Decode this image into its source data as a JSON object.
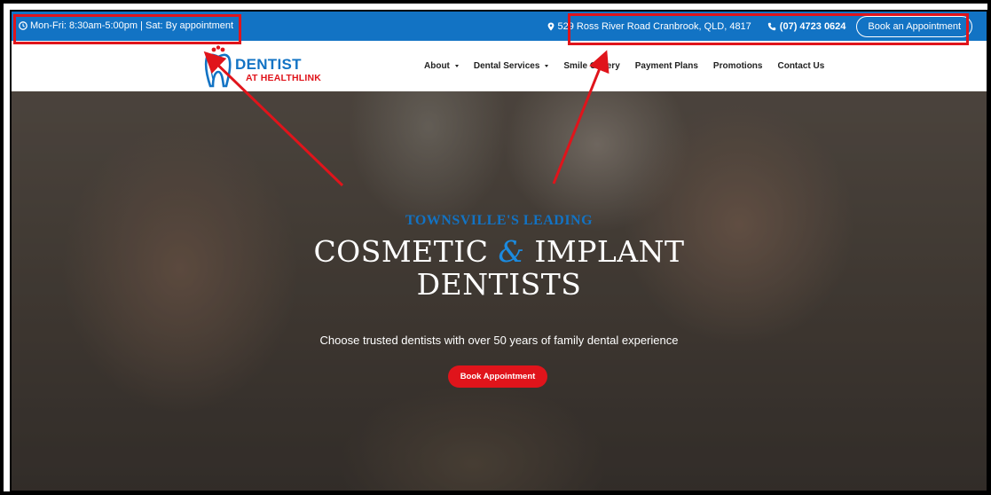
{
  "topbar": {
    "hours": "Mon-Fri: 8:30am-5:00pm | Sat: By appointment",
    "address": "529 Ross River Road Cranbrook, QLD, 4817",
    "phone": "(07) 4723 0624",
    "book_button": "Book an Appointment"
  },
  "logo": {
    "line1": "DENTIST",
    "line2": "AT HEALTHLINK"
  },
  "nav": {
    "items": [
      {
        "label": "About"
      },
      {
        "label": "Dental Services"
      },
      {
        "label": "Smile Gallery"
      },
      {
        "label": "Payment Plans"
      },
      {
        "label": "Promotions"
      },
      {
        "label": "Contact Us"
      }
    ]
  },
  "hero": {
    "kicker": "TOWNSVILLE'S LEADING",
    "headline_part1": "COSMETIC ",
    "headline_amp": "&",
    "headline_part2": " IMPLANT",
    "headline_line2": "DENTISTS",
    "subline": "Choose trusted dentists with over 50 years of family dental experience",
    "cta": "Book Appointment"
  },
  "colors": {
    "brand_blue": "#1273c4",
    "brand_red": "#e0141b",
    "annotation_red": "#e0141b"
  },
  "icons": [
    "clock-icon",
    "map-pin-icon",
    "phone-icon",
    "tooth-logo-icon"
  ]
}
